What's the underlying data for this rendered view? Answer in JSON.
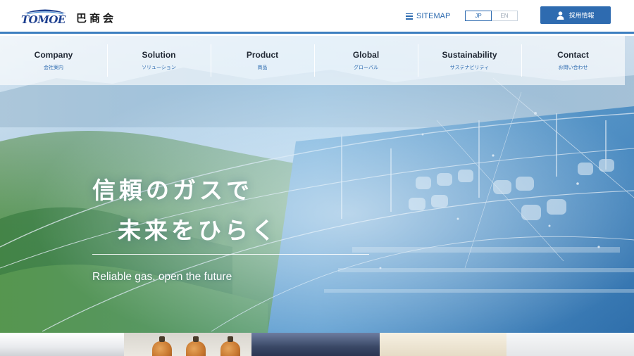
{
  "brand": {
    "logo_text": "TOMOE",
    "company_name_jp": "巴商会"
  },
  "header": {
    "sitemap_label": "SITEMAP",
    "lang_jp": "JP",
    "lang_en": "EN",
    "active_lang": "JP",
    "recruit_label": "採用情報"
  },
  "nav": {
    "items": [
      {
        "en": "Company",
        "jp": "会社案内"
      },
      {
        "en": "Solution",
        "jp": "ソリューション"
      },
      {
        "en": "Product",
        "jp": "商品"
      },
      {
        "en": "Global",
        "jp": "グローバル"
      },
      {
        "en": "Sustainability",
        "jp": "サステナビリティ"
      },
      {
        "en": "Contact",
        "jp": "お問い合わせ"
      }
    ]
  },
  "hero": {
    "catch_line_1": "信頼のガスで",
    "catch_line_2": "未来をひらく",
    "catch_en": "Reliable gas, open the future"
  },
  "colors": {
    "accent": "#2e6bb0",
    "header_border": "#3d7fc0",
    "text_dark": "#222a36"
  }
}
